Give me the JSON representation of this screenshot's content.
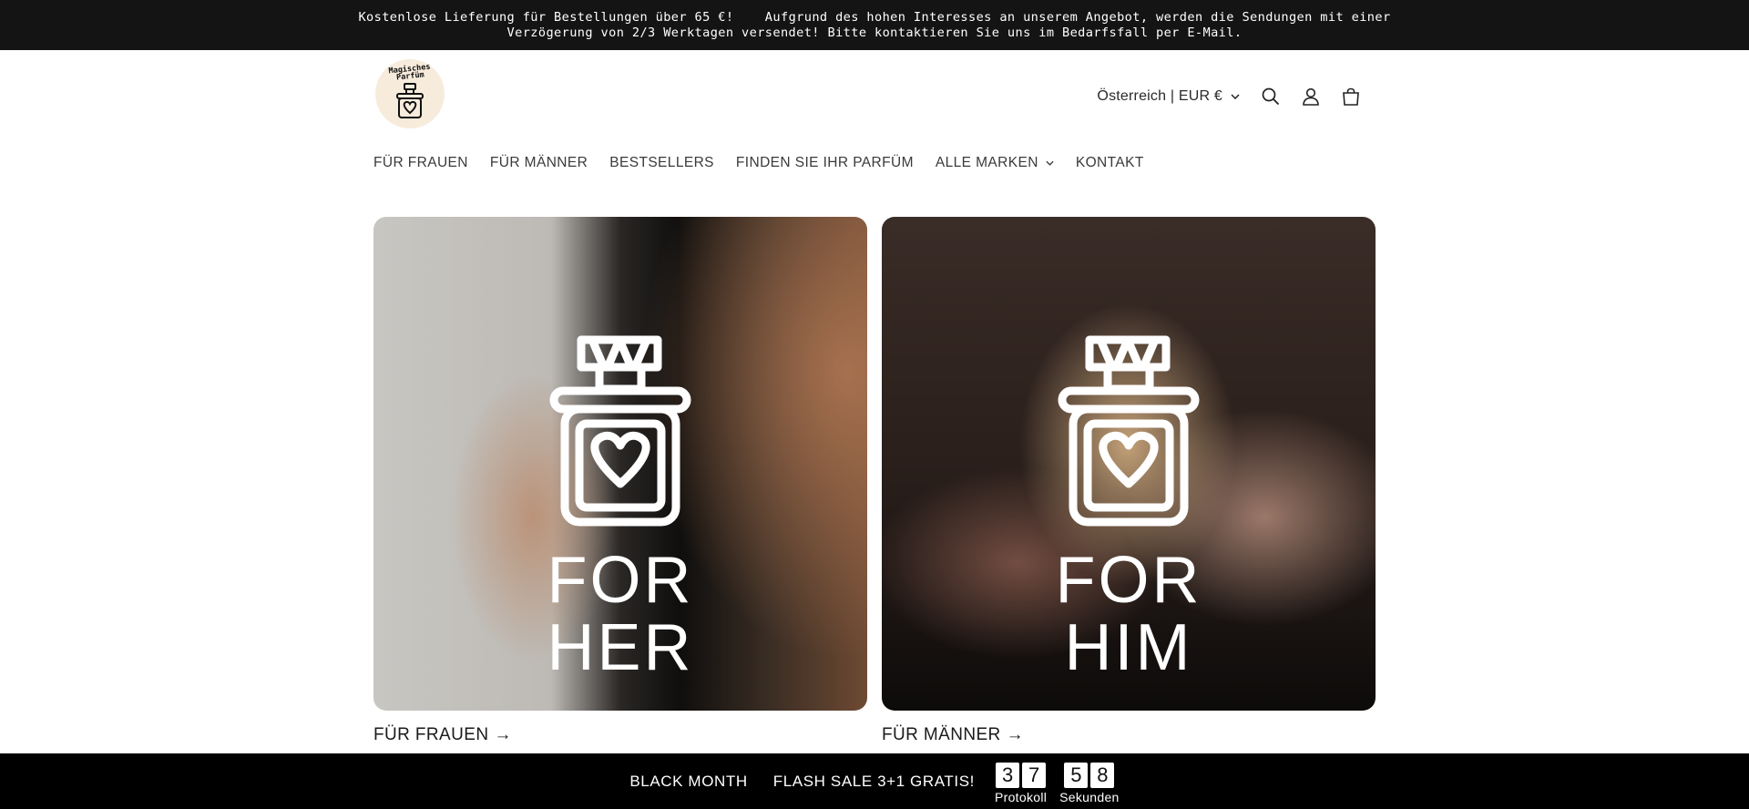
{
  "announcement": {
    "text": "Kostenlose Lieferung für Bestellungen über 65 €!    Aufgrund des hohen Interesses an unserem Angebot, werden die Sendungen mit einer Verzögerung von 2/3 Werktagen versendet! Bitte kontaktieren Sie uns im Bedarfsfall per E-Mail."
  },
  "header": {
    "logo_text": "Magisches Parfüm",
    "country_selector": "Österreich | EUR €",
    "icons": [
      "chevron-down-icon",
      "search-icon",
      "account-icon",
      "cart-icon"
    ]
  },
  "nav": {
    "items": [
      {
        "label": "FÜR FRAUEN"
      },
      {
        "label": "FÜR MÄNNER"
      },
      {
        "label": "BESTSELLERS"
      },
      {
        "label": "FINDEN SIE IHR PARFÜM"
      },
      {
        "label": "ALLE MARKEN",
        "has_dropdown": true
      },
      {
        "label": "KONTAKT"
      }
    ]
  },
  "collections": [
    {
      "image_line1": "FOR",
      "image_line2": "HER",
      "title": "FÜR FRAUEN",
      "arrow": "→"
    },
    {
      "image_line1": "FOR",
      "image_line2": "HIM",
      "title": "FÜR MÄNNER",
      "arrow": "→"
    }
  ],
  "flash_sale": {
    "label_1": "BLACK MONTH",
    "label_2": "FLASH SALE 3+1 GRATIS!",
    "minutes": {
      "d1": "3",
      "d2": "7",
      "label": "Protokoll"
    },
    "seconds": {
      "d1": "5",
      "d2": "8",
      "label": "Sekunden"
    }
  },
  "colors": {
    "announcement_bg": "#141414",
    "flash_bar_bg": "#000000",
    "logo_bg": "#f7ecdc"
  }
}
